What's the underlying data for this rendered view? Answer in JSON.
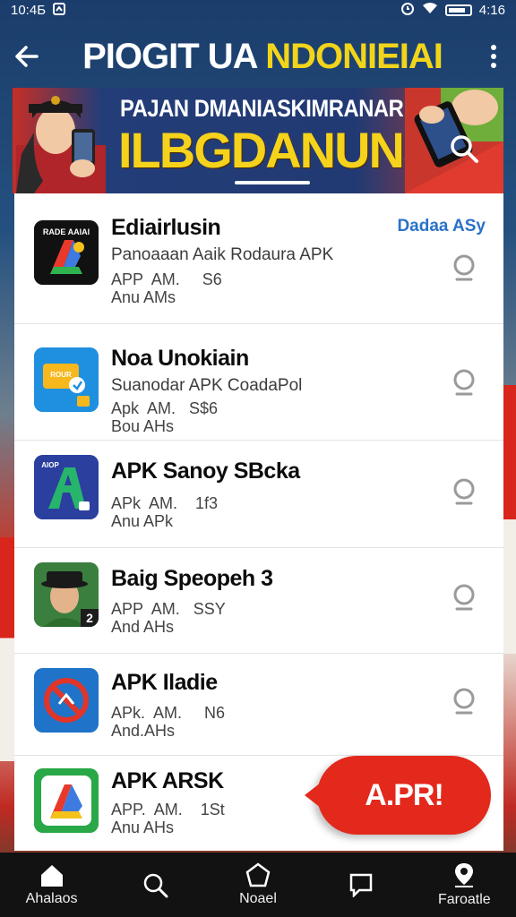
{
  "status_bar": {
    "time": "10:4Б",
    "battery_time": "4:16"
  },
  "header": {
    "title_part1": "PIOGIT UA",
    "title_part2": "NDONIEIAI",
    "back_icon": "arrow-left-icon",
    "more_icon": "more-vert-icon"
  },
  "banner": {
    "line1": "PAJAN DMANIASKIMRANAR",
    "line2": "ILBGDANUNSIA",
    "search_icon": "search-icon"
  },
  "list": {
    "side_link": "Dadaa ASy",
    "items": [
      {
        "name": "Ediairlusin",
        "subtitle": "Panoaaan Aaik Rodaura APK",
        "meta1": "APP  AM.     S6",
        "meta2": "Anu AMs",
        "icon_label": "RADE AAIAI",
        "icon_colors": [
          "#111111",
          "#e9392b",
          "#3d7be0",
          "#2fb34f",
          "#f5c21b"
        ]
      },
      {
        "name": "Noa Unokiain",
        "subtitle": "Suanodar APK CoadaPol",
        "meta1": "Apk  AM.   S$6",
        "meta2": "Bou AHs",
        "icon_label": "ROUR",
        "icon_colors": [
          "#1f8fe0",
          "#f6b81d"
        ]
      },
      {
        "name": "APK Sanoy SBcka",
        "subtitle": "",
        "meta1": "APk  AM.    1f3",
        "meta2": "Anu APk",
        "icon_label": "AIOP",
        "icon_colors": [
          "#2b3f9f",
          "#27b56c"
        ]
      },
      {
        "name": "Baig Speopeh 3",
        "subtitle": "",
        "meta1": "APP  AM.   SSY",
        "meta2": "And AHs",
        "icon_label": "2",
        "icon_colors": [
          "#2d7a3a",
          "#1c1c1c"
        ]
      },
      {
        "name": "APK Iladie",
        "subtitle": "",
        "meta1": "APk.  AM.     N6",
        "meta2": "And.AHs",
        "icon_label": "",
        "icon_colors": [
          "#1f73c9",
          "#e1352a"
        ]
      },
      {
        "name": "APK ARSK",
        "subtitle": "",
        "meta1": "APP.  AM.    1St",
        "meta2": "Anu AHs",
        "icon_label": "",
        "icon_colors": [
          "#29a847",
          "#e9392b",
          "#f5c21b",
          "#3d7be0"
        ]
      }
    ],
    "search_icon": "search-icon"
  },
  "promo_button": {
    "label": "A.PR!"
  },
  "bottom_nav": {
    "items": [
      {
        "label": "Ahalaos",
        "icon": "home-icon"
      },
      {
        "label": "",
        "icon": "search-icon"
      },
      {
        "label": "Noael",
        "icon": "pentagon-home-icon"
      },
      {
        "label": "",
        "icon": "square-chat-icon"
      },
      {
        "label": "Faroatle",
        "icon": "location-pin-icon"
      }
    ]
  },
  "colors": {
    "accent_yellow": "#f2d41a",
    "promo_red": "#e3281c",
    "link_blue": "#2a72c8",
    "nav_bg": "#121212"
  }
}
